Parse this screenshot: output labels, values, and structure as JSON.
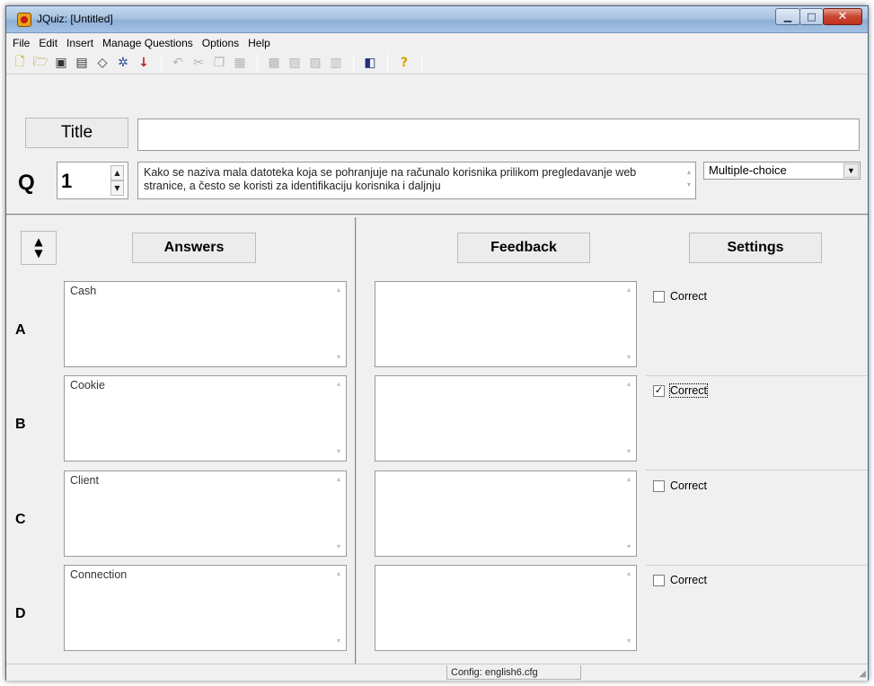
{
  "window": {
    "title": "JQuiz: [Untitled]",
    "minimize_icon": "minimize-icon",
    "maximize_icon": "maximize-icon",
    "close_icon": "close-icon"
  },
  "menu": [
    "File",
    "Edit",
    "Insert",
    "Manage Questions",
    "Options",
    "Help"
  ],
  "toolbar": {
    "icons": [
      "new-file-icon",
      "open-folder-icon",
      "save-icon",
      "save-as-icon",
      "erase-icon",
      "web-page-icon",
      "down-arrow-icon",
      "undo-icon",
      "cut-icon",
      "copy-icon",
      "paste-icon",
      "add-image-icon",
      "add-link-icon",
      "add-media-icon",
      "upload-icon",
      "export-icon",
      "help-icon"
    ]
  },
  "editor": {
    "title_label": "Title",
    "title_value": "",
    "q_label": "Q",
    "question_number": "1",
    "question_text": "Kako se naziva mala datoteka koja se pohranjuje na računalo korisnika prilikom pregledavanje web stranice, a često se koristi za identifikaciju korisnika i daljnju",
    "question_type": "Multiple-choice"
  },
  "headers": {
    "answers": "Answers",
    "feedback": "Feedback",
    "settings": "Settings"
  },
  "rows": [
    {
      "letter": "A",
      "answer": "Cash",
      "feedback": "",
      "correct_label": "Correct",
      "checked": false
    },
    {
      "letter": "B",
      "answer": "Cookie",
      "feedback": "",
      "correct_label": "Correct",
      "checked": true
    },
    {
      "letter": "C",
      "answer": "Client",
      "feedback": "",
      "correct_label": "Correct",
      "checked": false
    },
    {
      "letter": "D",
      "answer": "Connection",
      "feedback": "",
      "correct_label": "Correct",
      "checked": false
    }
  ],
  "status": {
    "config": "Config: english6.cfg"
  }
}
